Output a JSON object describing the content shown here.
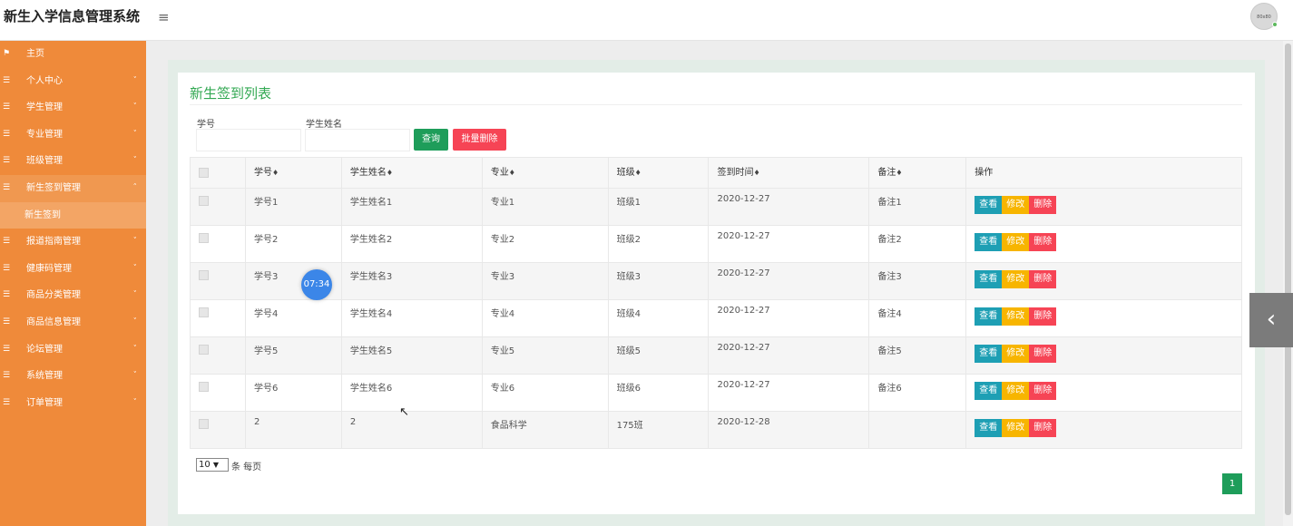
{
  "app": {
    "title": "新生入学信息管理系统",
    "avatar_text": "80x80"
  },
  "sidebar": {
    "items": [
      {
        "label": "主页",
        "icon": "flag-icon"
      },
      {
        "label": "个人中心",
        "icon": "list-icon"
      },
      {
        "label": "学生管理",
        "icon": "list-icon"
      },
      {
        "label": "专业管理",
        "icon": "list-icon"
      },
      {
        "label": "班级管理",
        "icon": "list-icon"
      },
      {
        "label": "新生签到管理",
        "icon": "list-icon",
        "open": true
      },
      {
        "label": "报道指南管理",
        "icon": "list-icon"
      },
      {
        "label": "健康码管理",
        "icon": "list-icon"
      },
      {
        "label": "商品分类管理",
        "icon": "list-icon"
      },
      {
        "label": "商品信息管理",
        "icon": "list-icon"
      },
      {
        "label": "论坛管理",
        "icon": "list-icon"
      },
      {
        "label": "系统管理",
        "icon": "list-icon"
      },
      {
        "label": "订单管理",
        "icon": "list-icon"
      }
    ],
    "sub_item": "新生签到"
  },
  "page": {
    "title": "新生签到列表",
    "search": {
      "id_label": "学号",
      "name_label": "学生姓名",
      "query_button": "查询",
      "batch_delete_button": "批量删除"
    }
  },
  "table": {
    "columns": [
      "学号",
      "学生姓名",
      "专业",
      "班级",
      "签到时间",
      "备注",
      "操作"
    ],
    "rows": [
      [
        "学号1",
        "学生姓名1",
        "专业1",
        "班级1",
        "2020-12-27",
        "备注1"
      ],
      [
        "学号2",
        "学生姓名2",
        "专业2",
        "班级2",
        "2020-12-27",
        "备注2"
      ],
      [
        "学号3",
        "学生姓名3",
        "专业3",
        "班级3",
        "2020-12-27",
        "备注3"
      ],
      [
        "学号4",
        "学生姓名4",
        "专业4",
        "班级4",
        "2020-12-27",
        "备注4"
      ],
      [
        "学号5",
        "学生姓名5",
        "专业5",
        "班级5",
        "2020-12-27",
        "备注5"
      ],
      [
        "学号6",
        "学生姓名6",
        "专业6",
        "班级6",
        "2020-12-27",
        "备注6"
      ],
      [
        "2",
        "2",
        "食品科学",
        "175班",
        "2020-12-28",
        ""
      ]
    ],
    "actions": {
      "view": "查看",
      "edit": "修改",
      "delete": "删除"
    }
  },
  "pagination": {
    "per_page_value": "10",
    "per_page_suffix": "条 每页",
    "current_page": "1"
  },
  "overlay": {
    "timer": "07:34"
  },
  "colors": {
    "sidebar": "#ef8a3a",
    "title": "#32a852",
    "query": "#1e9d5a",
    "batch_delete": "#f64455",
    "view": "#1e9fb4",
    "edit": "#f7b500",
    "delete": "#f64455"
  }
}
